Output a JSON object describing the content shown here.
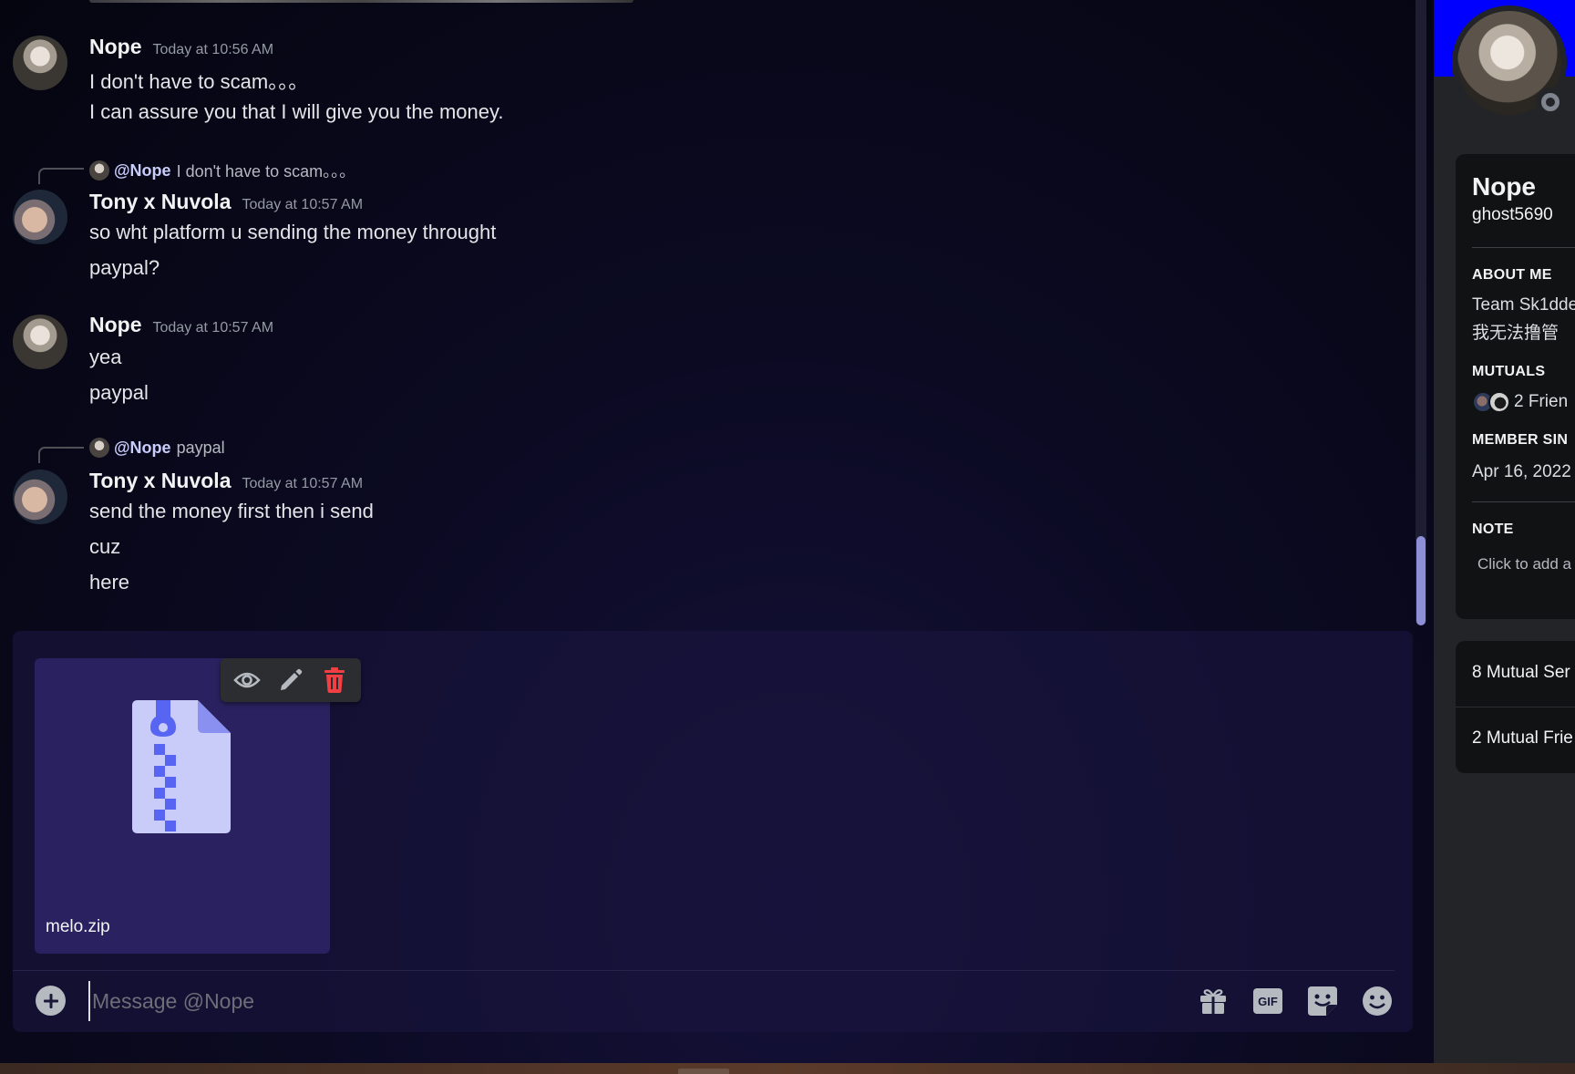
{
  "messages": [
    {
      "author": "Nope",
      "time": "Today at 10:56 AM",
      "lines": [
        "I don't have to scam。。。",
        "I can assure you that I will give you the money."
      ]
    },
    {
      "reply": {
        "mention": "@Nope",
        "text": "I don't have to scam。。。"
      },
      "author": "Tony x Nuvola",
      "time": "Today at 10:57 AM",
      "lines": [
        "so wht platform u sending the money throught",
        "paypal?"
      ]
    },
    {
      "author": "Nope",
      "time": "Today at 10:57 AM",
      "lines": [
        "yea",
        "paypal"
      ]
    },
    {
      "reply": {
        "mention": "@Nope",
        "text": "paypal"
      },
      "author": "Tony x Nuvola",
      "time": "Today at 10:57 AM",
      "lines": [
        "send the money first then i send",
        "cuz",
        "here"
      ]
    }
  ],
  "composer": {
    "attachment": {
      "filename": "melo.zip",
      "icon": "zip-file-icon"
    },
    "attachment_actions": [
      "eye-icon",
      "pencil-icon",
      "trash-icon"
    ],
    "placeholder": "Message @Nope",
    "value": "",
    "tools": [
      "gift-icon",
      "gif-icon",
      "sticker-icon",
      "emoji-icon"
    ],
    "gif_label": "GIF"
  },
  "profile": {
    "display_name": "Nope",
    "username": "ghost5690",
    "banner_color": "#0000ff",
    "status": "offline",
    "about_me_heading": "ABOUT ME",
    "about_me_lines": [
      "Team Sk1dde",
      "我无法撸管"
    ],
    "mutuals_heading": "MUTUALS",
    "mutuals_text": "2 Frien",
    "member_since_heading": "MEMBER SIN",
    "member_since": "Apr 16, 2022",
    "note_heading": "NOTE",
    "note_placeholder": "Click to add a",
    "mutual_servers": "8 Mutual Ser",
    "mutual_friends": "2 Mutual Frie"
  },
  "colors": {
    "accent": "#5865f2",
    "danger": "#f23f43",
    "attachment_bg": "#2a2260"
  }
}
